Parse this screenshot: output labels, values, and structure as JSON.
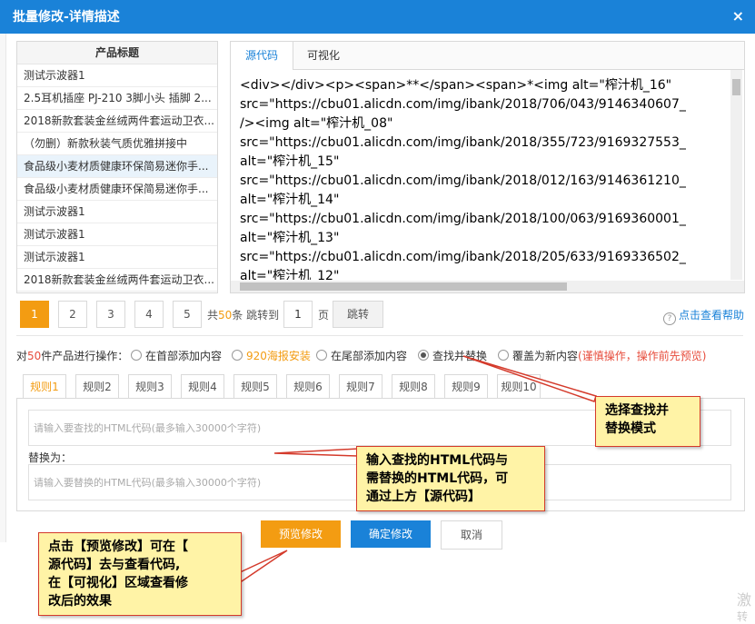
{
  "dialog": {
    "title": "批量修改-详情描述",
    "close_glyph": "×"
  },
  "product_list": {
    "header": "产品标题",
    "items": [
      "测试示波器1",
      "2.5耳机插座 PJ-210 3脚小头 插脚 2...",
      "2018新款套装金丝绒两件套运动卫衣...",
      "（勿删）新款秋装气质优雅拼接中",
      "食品级小麦材质健康环保简易迷你手...",
      "食品级小麦材质健康环保简易迷你手...",
      "测试示波器1",
      "测试示波器1",
      "测试示波器1",
      "2018新款套装金丝绒两件套运动卫衣..."
    ],
    "selected_index": 4
  },
  "editor": {
    "tabs": [
      "源代码",
      "可视化"
    ],
    "active_tab": 0,
    "code_lines": [
      "<div></div><p><span>**</span><span>*<img alt=\"榨汁机_16\"",
      "src=\"https://cbu01.alicdn.com/img/ibank/2018/706/043/9146340607_",
      "/><img alt=\"榨汁机_08\"",
      "src=\"https://cbu01.alicdn.com/img/ibank/2018/355/723/9169327553_",
      "alt=\"榨汁机_15\"",
      "src=\"https://cbu01.alicdn.com/img/ibank/2018/012/163/9146361210_",
      "alt=\"榨汁机_14\"",
      "src=\"https://cbu01.alicdn.com/img/ibank/2018/100/063/9169360001_",
      "alt=\"榨汁机_13\"",
      "src=\"https://cbu01.alicdn.com/img/ibank/2018/205/633/9169336502_",
      "alt=\"榨汁机_12\""
    ]
  },
  "pagination": {
    "pages": [
      "1",
      "2",
      "3",
      "4",
      "5"
    ],
    "active_page": "1",
    "total_prefix": "共",
    "total_count": "50",
    "total_suffix": "条 跳转到",
    "jump_value": "1",
    "page_unit": "页",
    "jump_button": "跳转"
  },
  "help": {
    "icon_glyph": "?",
    "label": "点击查看帮助"
  },
  "operations": {
    "prefix_a": "对",
    "count": "50",
    "prefix_b": "件产品进行操作：",
    "options": [
      "在首部添加内容",
      "920海报安装",
      "在尾部添加内容",
      "查找并替换",
      "覆盖为新内容"
    ],
    "selected_index": 3,
    "warning": "(谨慎操作，操作前先预览)"
  },
  "rules": {
    "tabs": [
      "规则1",
      "规则2",
      "规则3",
      "规则4",
      "规则5",
      "规则6",
      "规则7",
      "规则8",
      "规则9",
      "规则10"
    ],
    "active_tab": 0,
    "find_placeholder": "请输入要查找的HTML代码(最多输入30000个字符)",
    "replace_label": "替换为：",
    "replace_placeholder": "请输入要替换的HTML代码(最多输入30000个字符)"
  },
  "buttons": {
    "preview": "预览修改",
    "confirm": "确定修改",
    "cancel": "取消"
  },
  "annotations": {
    "callout_mode": [
      "选择查找并",
      "替换模式"
    ],
    "callout_input": [
      "输入查找的HTML代码与",
      "需替换的HTML代码，可",
      "通过上方【源代码】"
    ],
    "callout_preview": [
      "点击【预览修改】可在【",
      "源代码】去与查看代码,",
      "在【可视化】区域查看修",
      "改后的效果"
    ],
    "accent_color": "#d43a2b",
    "callout_bg": "#fff3a6"
  },
  "watermark": [
    "激",
    "转"
  ],
  "colors": {
    "primary": "#1a82d8",
    "orange": "#f39c12",
    "warning": "#e74c3c"
  }
}
